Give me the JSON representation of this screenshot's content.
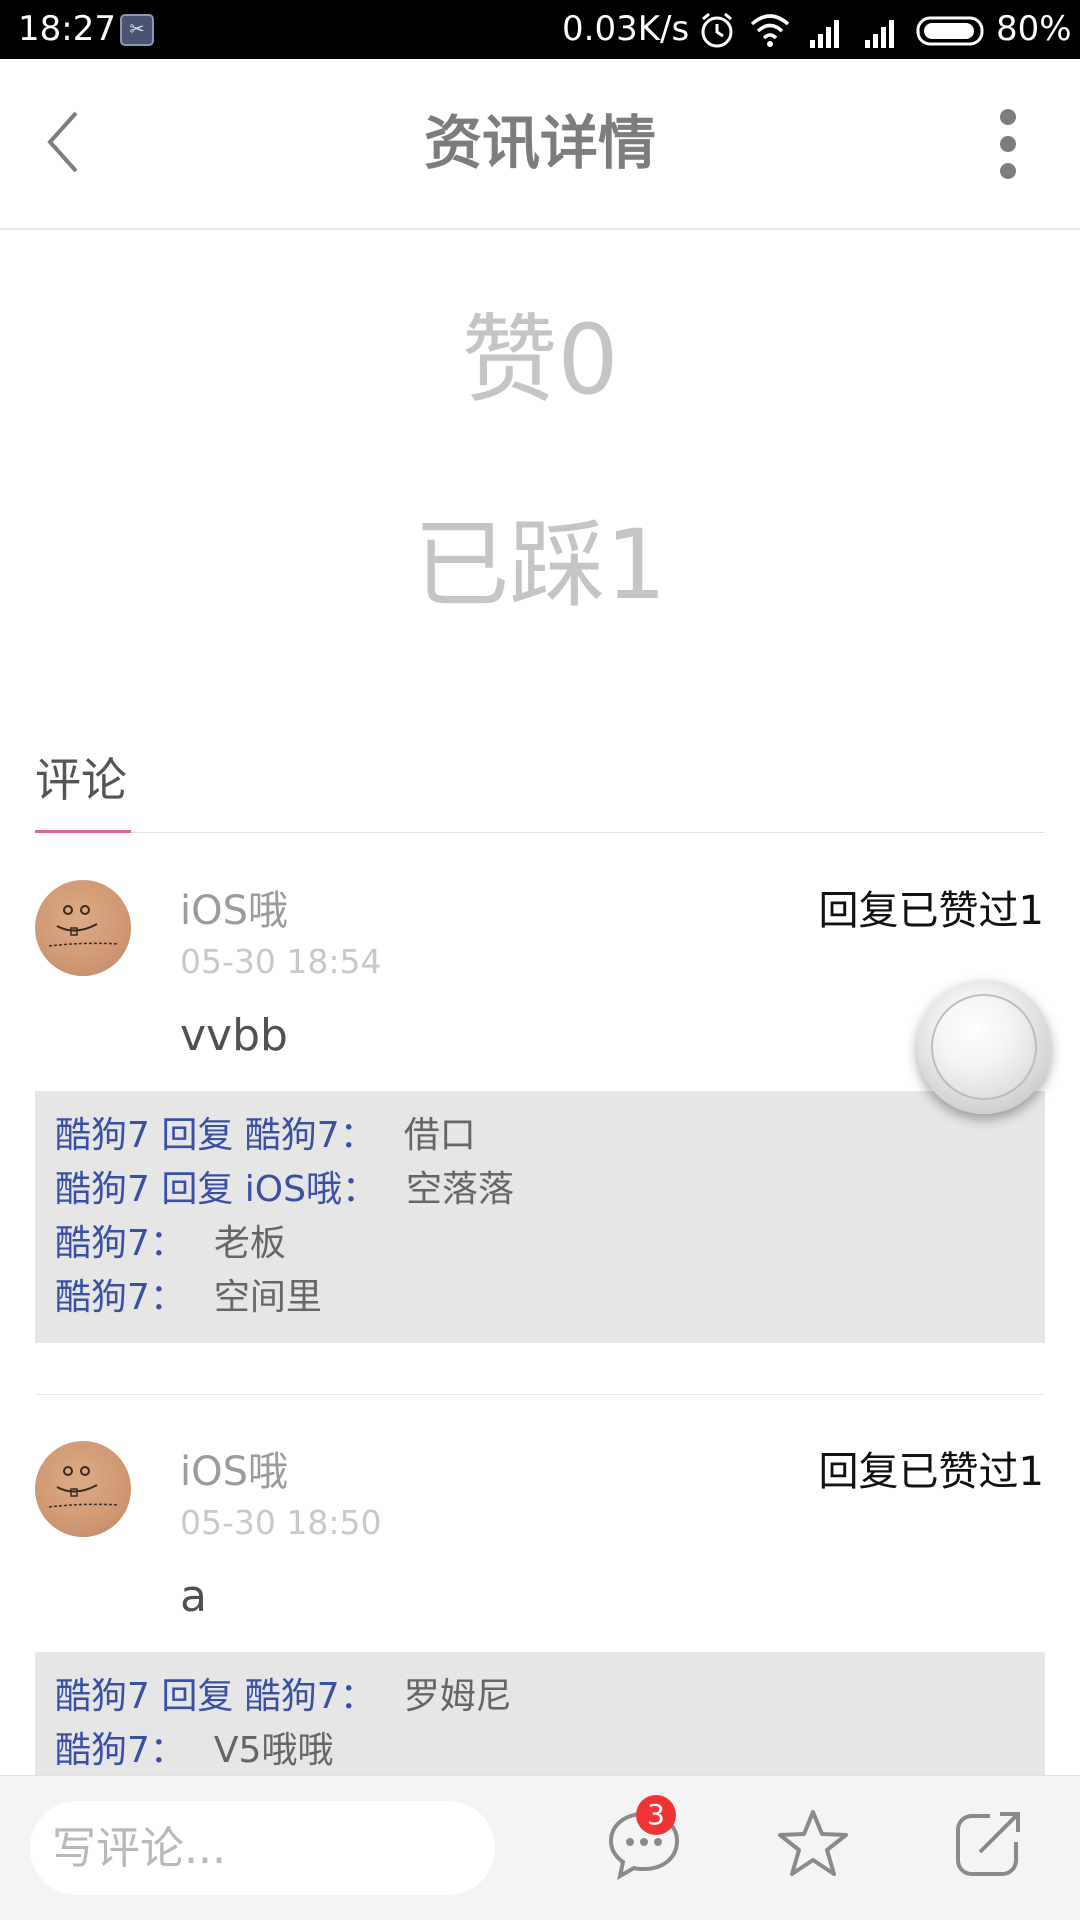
{
  "status_bar": {
    "time": "18:27",
    "network_speed": "0.03K/s",
    "battery": "80%",
    "icons": [
      "app-icon",
      "alarm-icon",
      "wifi-icon",
      "signal-icon",
      "signal-icon",
      "battery-icon"
    ]
  },
  "header": {
    "title": "资讯详情"
  },
  "stats": {
    "likes": "赞0",
    "dislikes": "已踩1"
  },
  "comments_tab": {
    "label": "评论"
  },
  "comments": [
    {
      "user": "iOS哦",
      "time": "05-30 18:54",
      "actions": "回复已赞过1",
      "text": "vvbb",
      "replies": [
        {
          "name": "酷狗7 回复 酷狗7：",
          "text": "借口"
        },
        {
          "name": "酷狗7 回复 iOS哦：",
          "text": "空落落"
        },
        {
          "name": "酷狗7：",
          "text": "老板"
        },
        {
          "name": "酷狗7：",
          "text": "空间里"
        }
      ]
    },
    {
      "user": "iOS哦",
      "time": "05-30 18:50",
      "actions": "回复已赞过1",
      "text": "a",
      "replies": [
        {
          "name": "酷狗7 回复 酷狗7：",
          "text": "罗姆尼"
        },
        {
          "name": "酷狗7：",
          "text": "V5哦哦"
        }
      ]
    }
  ],
  "bottom_bar": {
    "comment_placeholder": "写评论...",
    "comment_badge": "3",
    "icons": [
      "comment-icon",
      "star-icon",
      "share-icon"
    ]
  },
  "colors": {
    "accent_underline": "#e06a84",
    "reply_name": "#3a50a5",
    "badge": "#ee3434"
  }
}
